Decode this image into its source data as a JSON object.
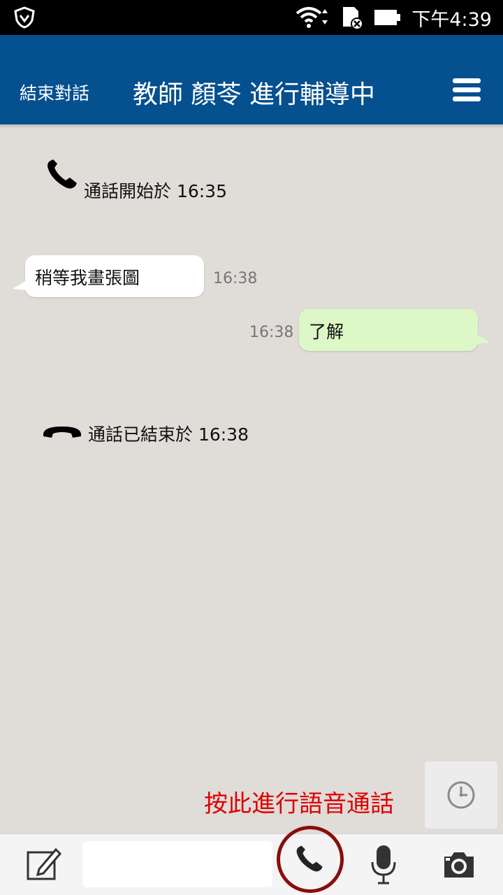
{
  "status_bar": {
    "time": "下午4:39"
  },
  "header": {
    "end_chat_label": "結束對話",
    "title": "教師 顏苓 進行輔導中"
  },
  "chat": {
    "call_started": "通話開始於 16:35",
    "messages": [
      {
        "direction": "incoming",
        "text": "稍等我畫張圖",
        "time": "16:38"
      },
      {
        "direction": "outgoing",
        "text": "了解",
        "time": "16:38"
      }
    ],
    "call_ended": "通話已結束於 16:38"
  },
  "hint": {
    "text": "按此進行語音通話",
    "color": "#e00000"
  },
  "input": {
    "placeholder": ""
  },
  "colors": {
    "header_bg": "#05508f",
    "chat_bg": "#e0dcd8",
    "outgoing_bubble": "#dcf8c6",
    "call_ring": "#8b0c0c"
  },
  "icons": [
    "shield-icon",
    "wifi-icon",
    "sd-card-icon",
    "battery-icon",
    "menu-icon",
    "phone-icon",
    "hangup-icon",
    "clock-icon",
    "edit-icon",
    "microphone-icon",
    "camera-icon"
  ]
}
